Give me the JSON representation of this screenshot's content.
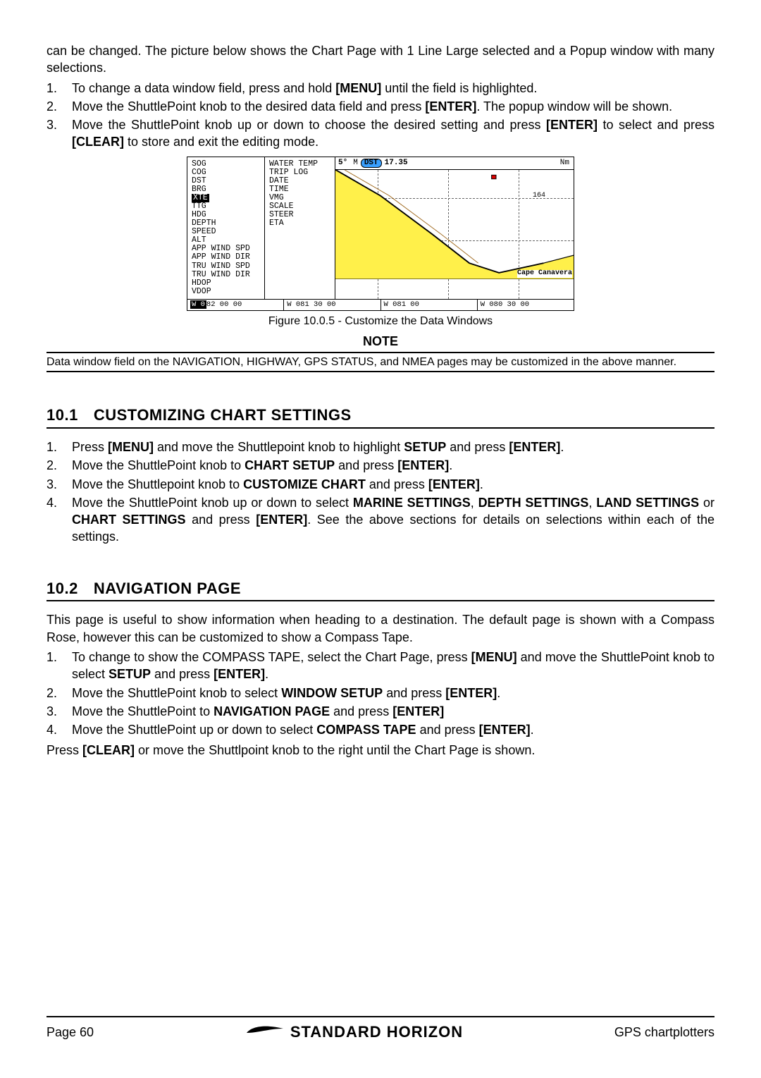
{
  "intro": "can be changed. The picture below shows the Chart Page with 1 Line Large selected and a Popup window with many selections.",
  "steps_a": [
    {
      "num": "1.",
      "plain1": "To change a data window field, press and hold ",
      "bold1": "[MENU]",
      "plain2": " until the field is highlighted."
    },
    {
      "num": "2.",
      "plain1": "Move the ShuttlePoint knob to the desired data field and press ",
      "bold1": "[ENTER]",
      "plain2": ". The popup window will be shown."
    },
    {
      "num": "3.",
      "plain1": "Move the ShuttlePoint knob up or down to choose the desired setting and press ",
      "bold1": "[ENTER]",
      "plain2": " to select and press ",
      "bold2": "[CLEAR]",
      "plain3": " to store and exit the editing mode."
    }
  ],
  "figure": {
    "popup_col1": [
      "SOG",
      "COG",
      "DST",
      "BRG",
      "XTE",
      "TTG",
      "HDG",
      "DEPTH",
      "SPEED",
      "ALT",
      "APP WIND SPD",
      "APP WIND DIR",
      "TRU WIND SPD",
      "TRU WIND DIR",
      "HDOP",
      "VDOP"
    ],
    "popup_highlight": "XTE",
    "popup_col2": [
      "WATER TEMP",
      "TRIP LOG",
      "DATE",
      "TIME",
      "VMG",
      "SCALE",
      "STEER",
      "ETA"
    ],
    "top": {
      "val1": "5°",
      "unit1": "M",
      "chip": "DST",
      "val2": "17.35",
      "unit2": "Nm"
    },
    "num164": "164",
    "cape": "Cape Canavera",
    "bottom": [
      "W 082 00 00",
      "W 081 30 00",
      "W 081 00",
      "W 080 30 00"
    ]
  },
  "fig_caption": "Figure 10.0.5 - Customize the Data Windows",
  "note_heading": "NOTE",
  "note_body": "Data window field on the NAVIGATION, HIGHWAY, GPS STATUS, and NMEA pages may be customized in the above manner.",
  "s101": {
    "num": "10.1",
    "title": "CUSTOMIZING CHART SETTINGS"
  },
  "steps_b": [
    {
      "num": "1.",
      "text": "Press [MENU] and move the Shuttlepoint knob to highlight SETUP and press [ENTER]."
    },
    {
      "num": "2.",
      "text": "Move the ShuttlePoint knob to CHART SETUP and press [ENTER]."
    },
    {
      "num": "3.",
      "text": "Move the Shuttlepoint knob to CUSTOMIZE CHART and press [ENTER]."
    },
    {
      "num": "4.",
      "text": "Move the ShuttlePoint knob up or down to select MARINE SETTINGS, DEPTH SETTINGS, LAND SETTINGS or CHART SETTINGS and press [ENTER]. See the above sections for details on selections within each of the settings."
    }
  ],
  "steps_b_html": [
    "Press <b>[MENU]</b> and move the Shuttlepoint knob to highlight <b>SETUP</b> and press <b>[ENTER]</b>.",
    "Move the ShuttlePoint knob to <b>CHART SETUP</b> and press <b>[ENTER]</b>.",
    "Move the Shuttlepoint knob to <b>CUSTOMIZE CHART</b> and press <b>[ENTER]</b>.",
    "Move the ShuttlePoint knob up or down to select <b>MARINE SETTINGS</b>, <b>DEPTH SETTINGS</b>, <b>LAND SETTINGS</b> or <b>CHART SETTINGS</b> and press <b>[ENTER]</b>. See the above sections for details on selections within each of the settings."
  ],
  "s102": {
    "num": "10.2",
    "title": "NAVIGATION PAGE"
  },
  "s102_para": "This page is useful to show information when heading to a destination. The default page is shown with a Compass Rose, however this can be customized to show a Compass Tape.",
  "steps_c_html": [
    "To change to show the COMPASS TAPE, select the Chart Page, press <b>[MENU]</b> and move the ShuttlePoint knob to select <b>SETUP</b> and press <b>[ENTER]</b>.",
    "Move the ShuttlePoint knob to select <b>WINDOW SETUP</b> and press <b>[ENTER]</b>.",
    "Move the ShuttlePoint to <b>NAVIGATION PAGE</b> and press <b>[ENTER]</b>",
    "Move the ShuttlePoint up or down to select <b>COMPASS TAPE</b> and press <b>[ENTER]</b>."
  ],
  "steps_c_nums": [
    "1.",
    "2.",
    "3.",
    "4."
  ],
  "closing": "Press <b>[CLEAR]</b> or move the Shuttlpoint knob to the right until the Chart Page is shown.",
  "footer": {
    "left": "Page 60",
    "center": "STANDARD HORIZON",
    "right": "GPS chartplotters"
  }
}
